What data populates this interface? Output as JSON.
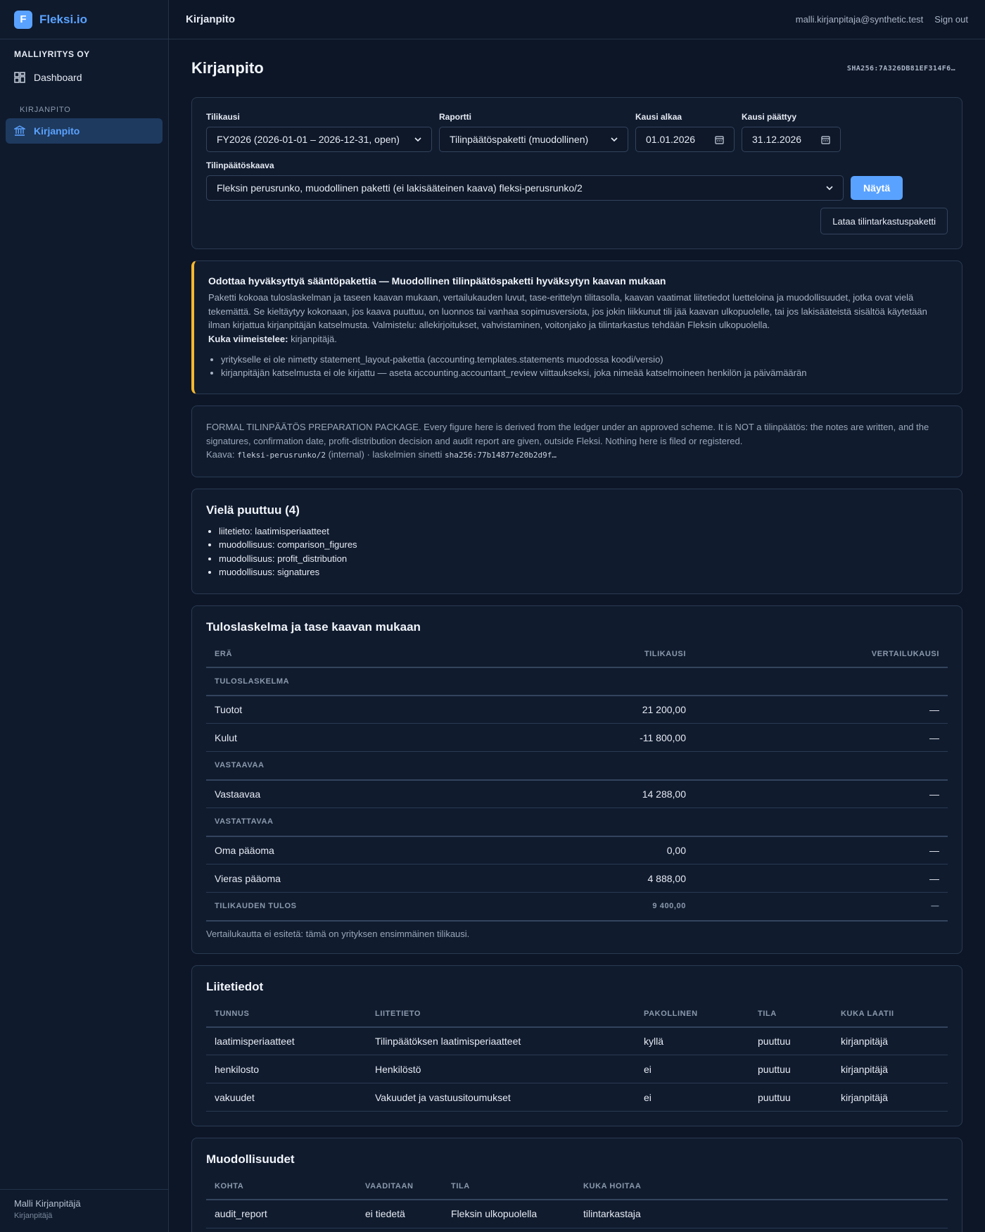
{
  "brand": {
    "logo_letter": "F",
    "name": "Fleksi.io"
  },
  "sidebar": {
    "company": "MALLIYRITYS OY",
    "dashboard_label": "Dashboard",
    "section_label": "KIRJANPITO",
    "kirjanpito_label": "Kirjanpito",
    "user_name": "Malli Kirjanpitäjä",
    "user_role": "Kirjanpitäjä"
  },
  "topbar": {
    "title": "Kirjanpito",
    "email": "malli.kirjanpitaja@synthetic.test",
    "signout": "Sign out"
  },
  "page": {
    "title": "Kirjanpito",
    "hash": "SHA256:7A326DB81EF314F6…"
  },
  "form": {
    "tilikausi_label": "Tilikausi",
    "tilikausi_value": "FY2026 (2026-01-01 – 2026-12-31, open)",
    "raportti_label": "Raportti",
    "raportti_value": "Tilinpäätöspaketti (muodollinen)",
    "kausi_alkaa_label": "Kausi alkaa",
    "kausi_alkaa_value": "01.01.2026",
    "kausi_paattyy_label": "Kausi päättyy",
    "kausi_paattyy_value": "31.12.2026",
    "kaava_label": "Tilinpäätöskaava",
    "kaava_value": "Fleksin perusrunko, muodollinen paketti (ei lakisääteinen kaava) fleksi-perusrunko/2",
    "nayta_button": "Näytä",
    "download_button": "Lataa tilintarkastuspaketti"
  },
  "warning": {
    "title": "Odottaa hyväksyttyä sääntöpakettia — Muodollinen tilinpäätöspaketti hyväksytyn kaavan mukaan",
    "body": "Paketti kokoaa tuloslaskelman ja taseen kaavan mukaan, vertailukauden luvut, tase-erittelyn tilitasolla, kaavan vaatimat liitetiedot luetteloina ja muodollisuudet, jotka ovat vielä tekemättä. Se kieltäytyy kokonaan, jos kaava puuttuu, on luonnos tai vanhaa sopimusversiota, jos jokin liikkunut tili jää kaavan ulkopuolelle, tai jos lakisääteistä sisältöä käytetään ilman kirjattua kirjanpitäjän katselmusta. Valmistelu: allekirjoitukset, vahvistaminen, voitonjako ja tilintarkastus tehdään Fleksin ulkopuolella.",
    "who_label": "Kuka viimeistelee:",
    "who_value": "kirjanpitäjä.",
    "items": [
      "yritykselle ei ole nimetty statement_layout-pakettia (accounting.templates.statements muodossa koodi/versio)",
      "kirjanpitäjän katselmusta ei ole kirjattu — aseta accounting.accountant_review viittaukseksi, joka nimeää katselmoineen henkilön ja päivämäärän"
    ]
  },
  "info": {
    "body": "FORMAL TILINPÄÄTÖS PREPARATION PACKAGE. Every figure here is derived from the ledger under an approved scheme. It is NOT a tilinpäätös: the notes are written, and the signatures, confirmation date, profit-distribution decision and audit report are given, outside Fleksi. Nothing here is filed or registered.",
    "kaava_prefix": "Kaava:",
    "kaava_code": "fleksi-perusrunko/2",
    "kaava_suffix": "(internal) · laskelmien sinetti",
    "seal": "sha256:77b14877e20b2d9f…"
  },
  "missing": {
    "title": "Vielä puuttuu (4)",
    "items": [
      "liitetieto: laatimisperiaatteet",
      "muodollisuus: comparison_figures",
      "muodollisuus: profit_distribution",
      "muodollisuus: signatures"
    ]
  },
  "statements": {
    "title": "Tuloslaskelma ja tase kaavan mukaan",
    "headers": [
      "ERÄ",
      "TILIKAUSI",
      "VERTAILUKAUSI"
    ],
    "sections": [
      {
        "name": "TULOSLASKELMA",
        "rows": [
          {
            "label": "Tuotot",
            "value": "21 200,00",
            "comp": "—"
          },
          {
            "label": "Kulut",
            "value": "-11 800,00",
            "comp": "—"
          }
        ]
      },
      {
        "name": "VASTAAVAA",
        "rows": [
          {
            "label": "Vastaavaa",
            "value": "14 288,00",
            "comp": "—"
          }
        ]
      },
      {
        "name": "VASTATTAVAA",
        "rows": [
          {
            "label": "Oma pääoma",
            "value": "0,00",
            "comp": "—"
          },
          {
            "label": "Vieras pääoma",
            "value": "4 888,00",
            "comp": "—"
          }
        ]
      }
    ],
    "total": {
      "label": "TILIKAUDEN TULOS",
      "value": "9 400,00",
      "comp": "—"
    },
    "note": "Vertailukautta ei esitetä: tämä on yrityksen ensimmäinen tilikausi."
  },
  "notes": {
    "title": "Liitetiedot",
    "headers": [
      "TUNNUS",
      "LIITETIETO",
      "PAKOLLINEN",
      "TILA",
      "KUKA LAATII"
    ],
    "rows": [
      [
        "laatimisperiaatteet",
        "Tilinpäätöksen laatimisperiaatteet",
        "kyllä",
        "puuttuu",
        "kirjanpitäjä"
      ],
      [
        "henkilosto",
        "Henkilöstö",
        "ei",
        "puuttuu",
        "kirjanpitäjä"
      ],
      [
        "vakuudet",
        "Vakuudet ja vastuusitoumukset",
        "ei",
        "puuttuu",
        "kirjanpitäjä"
      ]
    ]
  },
  "formalities": {
    "title": "Muodollisuudet",
    "headers": [
      "KOHTA",
      "VAADITAAN",
      "TILA",
      "KUKA HOITAA"
    ],
    "rows": [
      [
        "audit_report",
        "ei tiedetä",
        "Fleksin ulkopuolella",
        "tilintarkastaja"
      ]
    ]
  }
}
